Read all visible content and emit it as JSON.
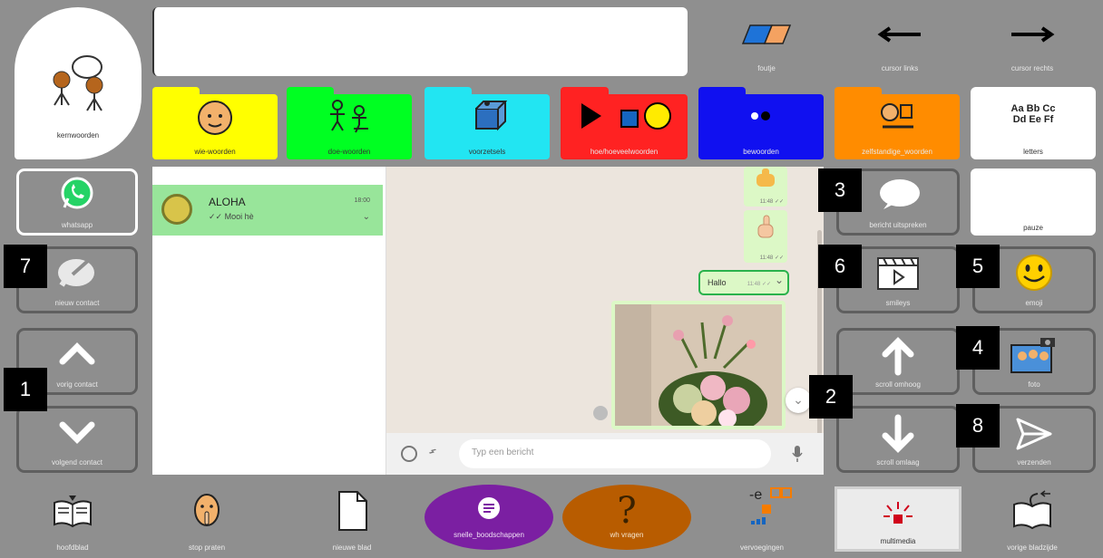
{
  "top": {
    "kernwoorden": "kernwoorden",
    "text_value": "",
    "foutje": "foutje",
    "cursor_links": "cursor links",
    "cursor_rechts": "cursor rechts"
  },
  "folders": [
    {
      "label": "wie-woorden",
      "color": "#ffff00"
    },
    {
      "label": "doe-woorden",
      "color": "#00ff22"
    },
    {
      "label": "voorzetsels",
      "color": "#22e5f2"
    },
    {
      "label": "hoe/hoeveelwoorden",
      "color": "#ff2222"
    },
    {
      "label": "bewoorden",
      "color": "#1010f0"
    },
    {
      "label": "zelfstandige_woorden",
      "color": "#ff8c00"
    }
  ],
  "letters": {
    "text": "Aa Bb Cc\nDd Ee Ff",
    "label": "letters"
  },
  "left": {
    "whatsapp": "whatsapp",
    "nieuw_contact": "nieuw contact",
    "vorig_contact": "vorig contact",
    "volgend_contact": "volgend contact"
  },
  "right": {
    "bericht_uitspreken": "bericht uitspreken",
    "pauze": "pauze",
    "smileys": "smileys",
    "emoji": "emoji",
    "scroll_omhoog": "scroll omhoog",
    "foto": "foto",
    "scroll_omlaag": "scroll omlaag",
    "verzenden": "verzenden"
  },
  "chat": {
    "contact_name": "ALOHA",
    "contact_time": "18:00",
    "contact_preview": "✓✓ Mooi hè",
    "msg_time_1": "11:48 ✓✓",
    "msg_time_2": "11:48 ✓✓",
    "msg_text": "Hallo",
    "msg_time_3": "11:48 ✓✓",
    "input_placeholder": "Typ een bericht"
  },
  "bottom": {
    "woordenboek": "hoofdblad",
    "stop_praten": "stop praten",
    "nieuwe_blad": "nieuwe blad",
    "snelle_boodschappen": "snelle_boodschappen",
    "wh_vragen": "wh vragen",
    "vervoegingen": "vervoegingen",
    "multimedia": "multimedia",
    "vorige_bladzijde": "vorige bladzijde"
  },
  "badges": [
    "1",
    "2",
    "3",
    "4",
    "5",
    "6",
    "7",
    "8"
  ],
  "colors": {
    "bg": "#8f8f8f",
    "chat_bg": "#ece5dd",
    "chat_selected": "#98e59a",
    "bubble": "#dcf8c6",
    "purple": "#7b1fa2",
    "brown": "#b85c00"
  }
}
